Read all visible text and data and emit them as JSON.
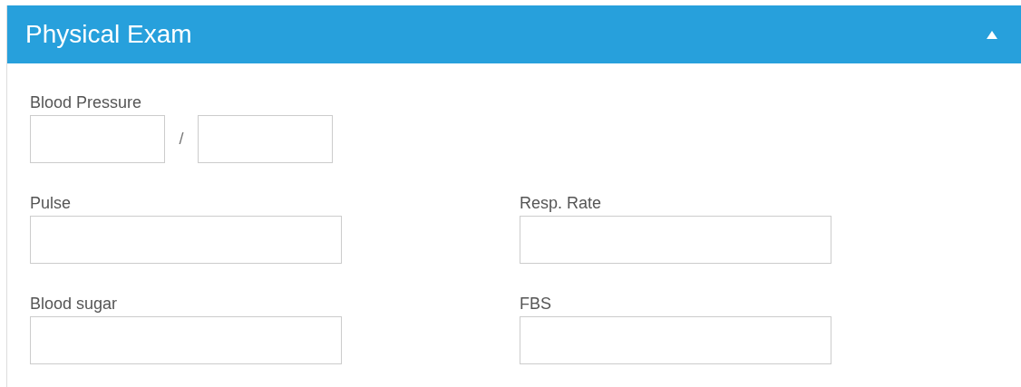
{
  "panel": {
    "title": "Physical Exam",
    "expanded": true
  },
  "blood_pressure": {
    "label": "Blood Pressure",
    "separator": "/"
  },
  "rows": [
    {
      "fields": [
        {
          "label": "Pulse"
        },
        {
          "label": "Resp. Rate"
        }
      ]
    },
    {
      "fields": [
        {
          "label": "Blood sugar"
        },
        {
          "label": "FBS"
        }
      ]
    }
  ]
}
